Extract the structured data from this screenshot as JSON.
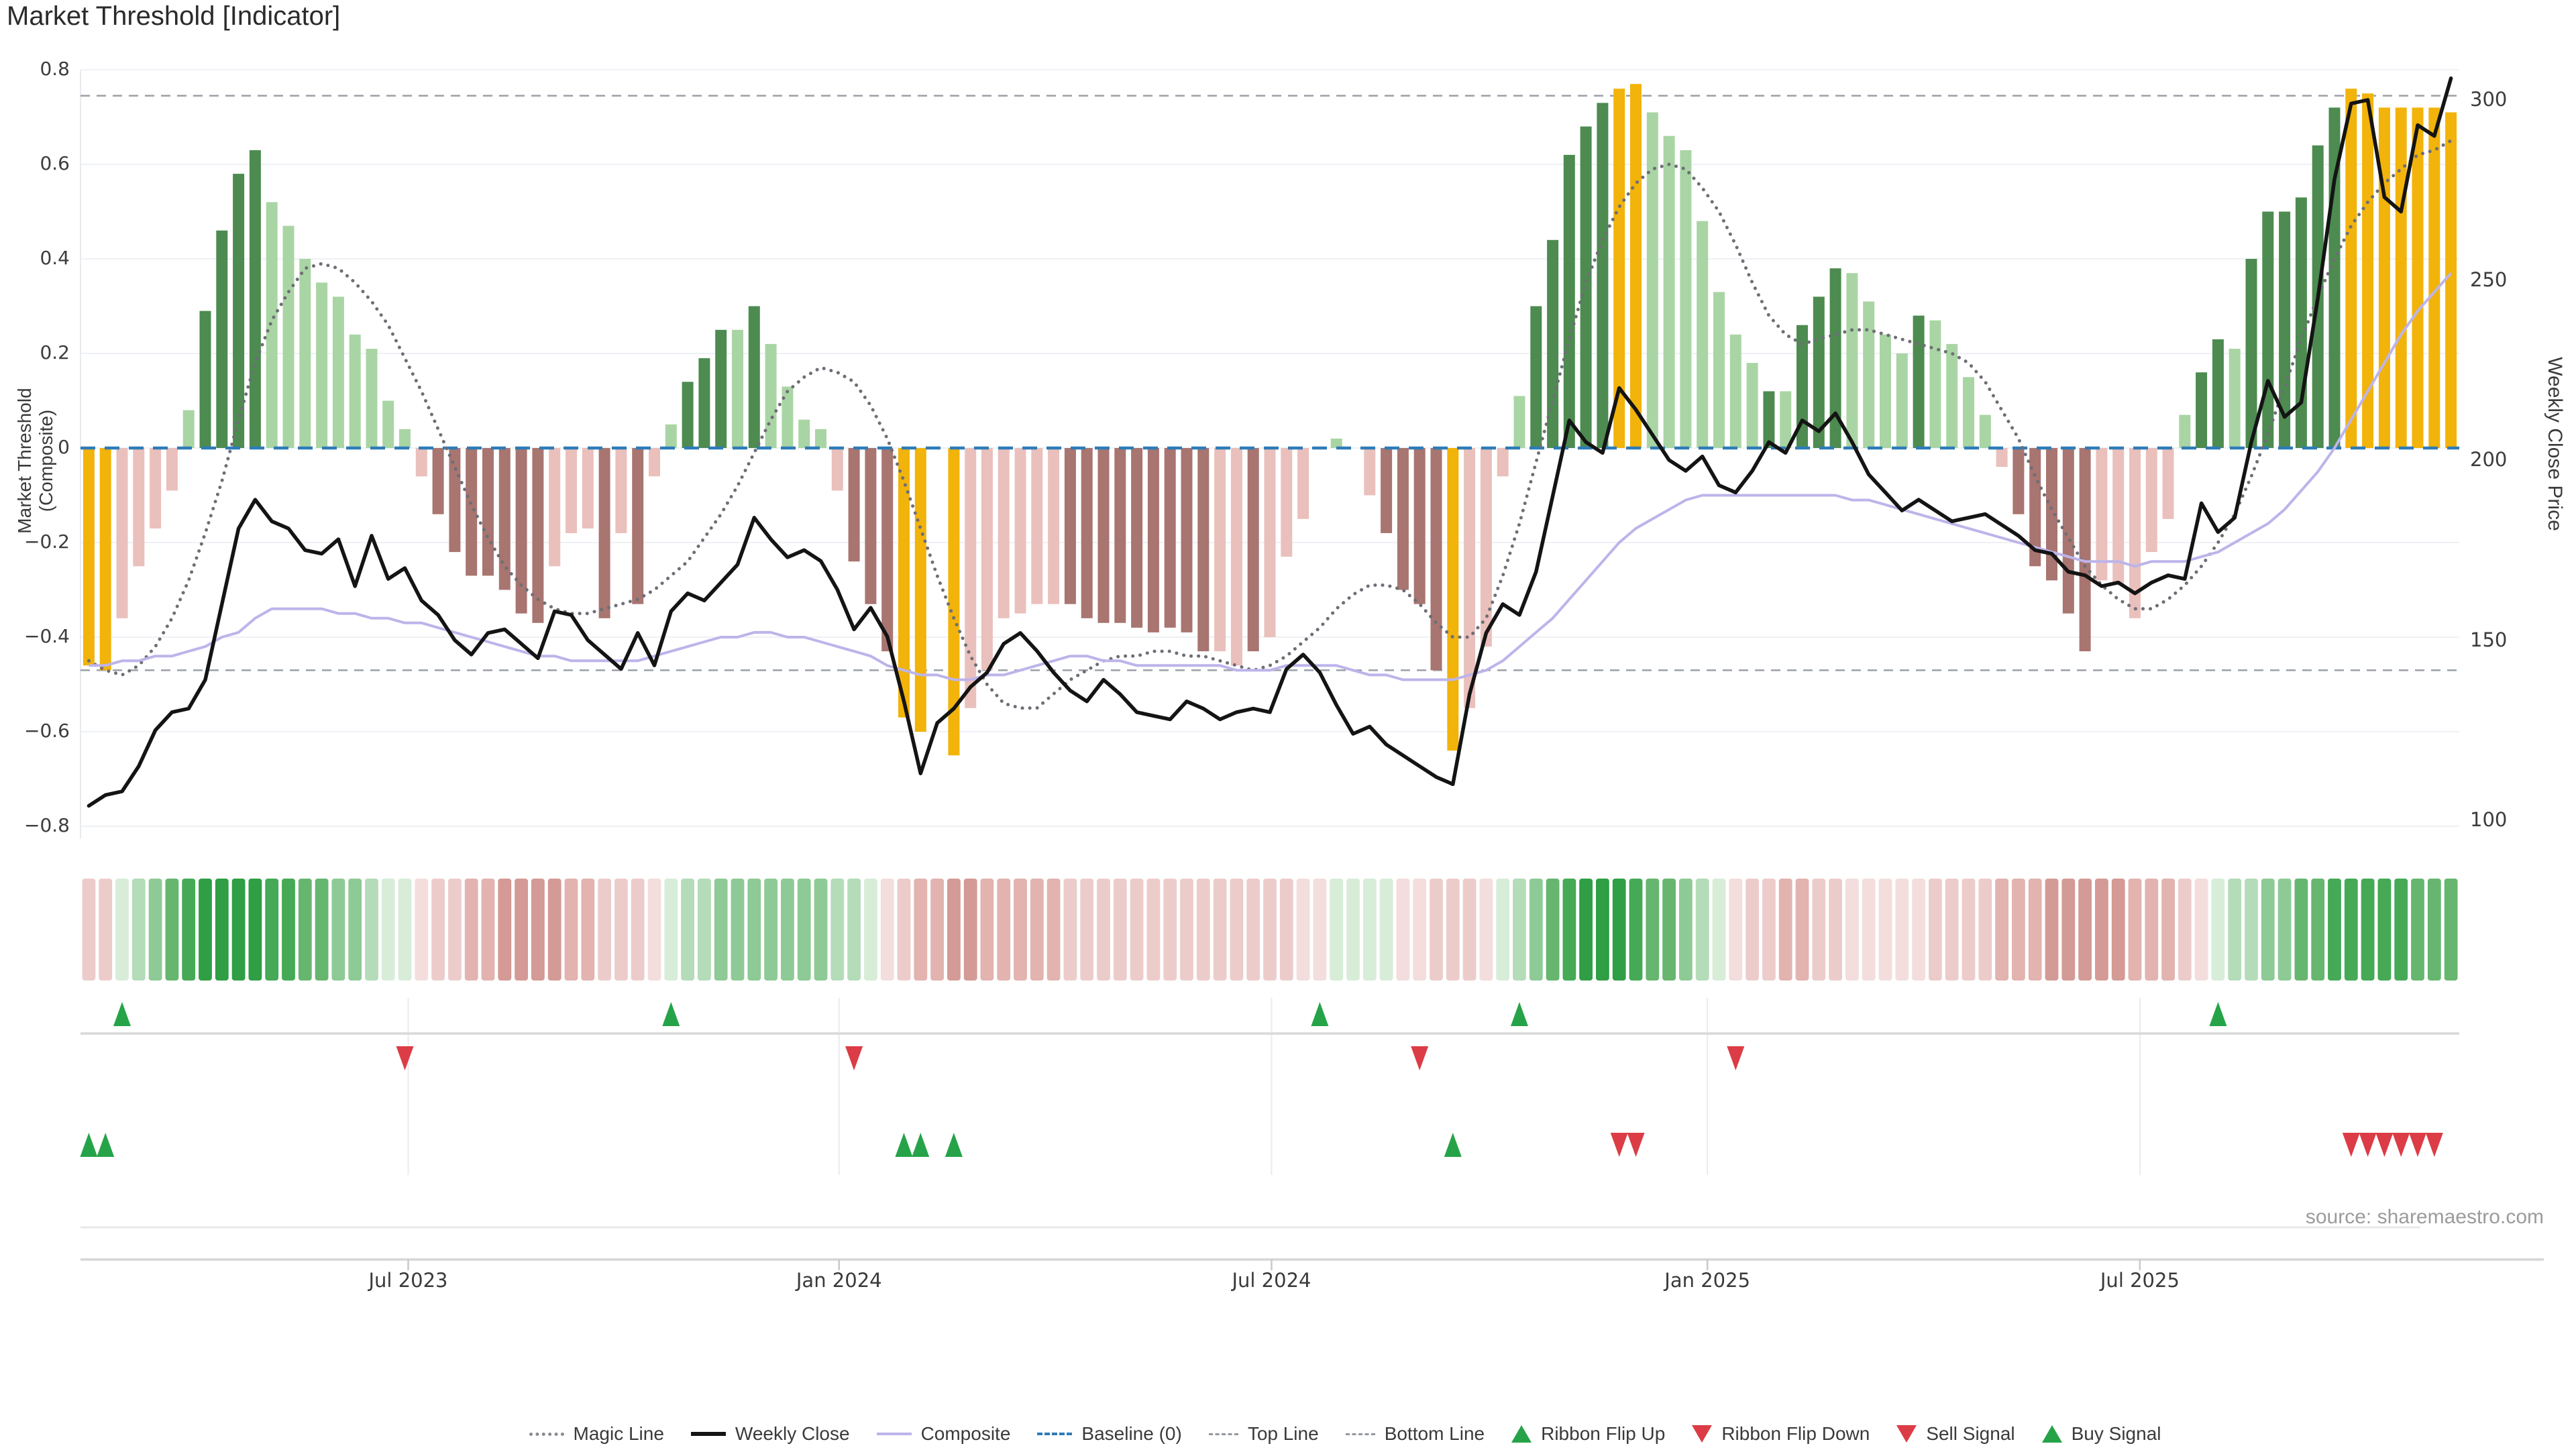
{
  "title": "Market Threshold [Indicator]",
  "source": "source: sharemaestro.com",
  "axes": {
    "left_label": "Market Threshold (Composite)",
    "right_label": "Weekly Close Price",
    "left_ticks": [
      0.8,
      0.6,
      0.4,
      0.2,
      0,
      -0.2,
      -0.4,
      -0.6,
      -0.8
    ],
    "left_tick_labels": [
      "0.8",
      "0.6",
      "0.4",
      "0.2",
      "0",
      "−0.2",
      "−0.4",
      "−0.6",
      "−0.8"
    ],
    "right_ticks": [
      300,
      250,
      200,
      150,
      100
    ],
    "x_ticks": [
      "Jul 2023",
      "Jan 2024",
      "Jul 2024",
      "Jan 2025",
      "Jul 2025"
    ],
    "x_tick_weeks": [
      19.7,
      45.6,
      71.6,
      97.8,
      123.8
    ]
  },
  "chart_data": {
    "type": "bar+line",
    "title": "Market Threshold [Indicator]",
    "ylabel_left": "Market Threshold (Composite)",
    "ylabel_right": "Weekly Close Price",
    "left_range": [
      -0.8,
      0.8
    ],
    "right_range": [
      100,
      300
    ],
    "baseline": 0,
    "top_line": 0.745,
    "bottom_line": -0.47,
    "grid": "horizontal",
    "n_weeks": 143,
    "threshold": [
      -0.46,
      -0.47,
      -0.36,
      -0.25,
      -0.17,
      -0.09,
      0.08,
      0.29,
      0.46,
      0.58,
      0.63,
      0.52,
      0.47,
      0.4,
      0.35,
      0.32,
      0.24,
      0.21,
      0.1,
      0.04,
      -0.06,
      -0.14,
      -0.22,
      -0.27,
      -0.27,
      -0.3,
      -0.35,
      -0.37,
      -0.25,
      -0.18,
      -0.17,
      -0.36,
      -0.18,
      -0.33,
      -0.06,
      0.05,
      0.14,
      0.19,
      0.25,
      0.25,
      0.3,
      0.22,
      0.13,
      0.06,
      0.04,
      -0.09,
      -0.24,
      -0.33,
      -0.43,
      -0.57,
      -0.6,
      0,
      -0.65,
      -0.55,
      -0.47,
      -0.36,
      -0.35,
      -0.33,
      -0.33,
      -0.33,
      -0.36,
      -0.37,
      -0.37,
      -0.38,
      -0.39,
      -0.38,
      -0.39,
      -0.43,
      -0.43,
      -0.46,
      -0.43,
      -0.4,
      -0.23,
      -0.15,
      0,
      0.02,
      0,
      -0.1,
      -0.18,
      -0.3,
      -0.33,
      -0.47,
      -0.64,
      -0.55,
      -0.42,
      -0.06,
      0.11,
      0.3,
      0.44,
      0.62,
      0.68,
      0.73,
      0.76,
      0.77,
      0.71,
      0.66,
      0.63,
      0.48,
      0.33,
      0.24,
      0.18,
      0.12,
      0.12,
      0.26,
      0.32,
      0.38,
      0.37,
      0.31,
      0.24,
      0.2,
      0.28,
      0.27,
      0.22,
      0.15,
      0.07,
      -0.04,
      -0.14,
      -0.25,
      -0.28,
      -0.35,
      -0.43,
      -0.28,
      -0.29,
      -0.36,
      -0.22,
      -0.15,
      0.07,
      0.16,
      0.23,
      0.21,
      0.4,
      0.5,
      0.5,
      0.53,
      0.64,
      0.72,
      0.76,
      0.75,
      0.72,
      0.72,
      0.72,
      0.72,
      0.71
    ],
    "bar_color_codes": [
      "au",
      "au",
      "p",
      "p",
      "p",
      "p",
      "lg",
      "g",
      "g",
      "g",
      "g",
      "lg",
      "lg",
      "lg",
      "lg",
      "lg",
      "lg",
      "lg",
      "lg",
      "lg",
      "p",
      "b",
      "b",
      "b",
      "b",
      "b",
      "b",
      "b",
      "p",
      "p",
      "p",
      "b",
      "p",
      "b",
      "p",
      "lg",
      "g",
      "g",
      "g",
      "lg",
      "g",
      "lg",
      "lg",
      "lg",
      "lg",
      "p",
      "b",
      "b",
      "b",
      "au",
      "au",
      "z",
      "au",
      "p",
      "p",
      "p",
      "p",
      "p",
      "p",
      "b",
      "b",
      "b",
      "b",
      "b",
      "b",
      "b",
      "b",
      "b",
      "p",
      "p",
      "b",
      "p",
      "p",
      "p",
      "z",
      "lg",
      "z",
      "p",
      "b",
      "b",
      "b",
      "b",
      "au",
      "p",
      "p",
      "p",
      "lg",
      "g",
      "g",
      "g",
      "g",
      "g",
      "au",
      "au",
      "lg",
      "lg",
      "lg",
      "lg",
      "lg",
      "lg",
      "lg",
      "g",
      "lg",
      "g",
      "g",
      "g",
      "lg",
      "lg",
      "lg",
      "lg",
      "g",
      "lg",
      "lg",
      "lg",
      "lg",
      "p",
      "b",
      "b",
      "b",
      "b",
      "b",
      "p",
      "p",
      "p",
      "p",
      "p",
      "lg",
      "g",
      "g",
      "lg",
      "g",
      "g",
      "g",
      "g",
      "g",
      "g",
      "au",
      "au",
      "au",
      "au",
      "au",
      "au",
      "au"
    ],
    "weekly_close": [
      104,
      107,
      108,
      115,
      125,
      130,
      131,
      139,
      160,
      181,
      189,
      183,
      181,
      175,
      174,
      178,
      165,
      179,
      167,
      170,
      161,
      157,
      150,
      146,
      152,
      153,
      149,
      145,
      158,
      157,
      150,
      146,
      142,
      152,
      143,
      158,
      163,
      161,
      166,
      171,
      184,
      178,
      173,
      175,
      172,
      164,
      153,
      159,
      151,
      133,
      113,
      127,
      131,
      137,
      141,
      149,
      152,
      147,
      141,
      136,
      133,
      139,
      135,
      130,
      129,
      128,
      133,
      131,
      128,
      130,
      131,
      130,
      142,
      146,
      141,
      132,
      124,
      126,
      121,
      118,
      115,
      112,
      110,
      135,
      152,
      160,
      157,
      169,
      190,
      211,
      205,
      202,
      220,
      214,
      207,
      200,
      197,
      201,
      193,
      191,
      197,
      205,
      202,
      211,
      208,
      213,
      205,
      196,
      191,
      186,
      189,
      186,
      183,
      184,
      185,
      182,
      179,
      175,
      174,
      169,
      168,
      165,
      166,
      163,
      166,
      168,
      167,
      188,
      180,
      184,
      205,
      222,
      212,
      216,
      245,
      278,
      299,
      300,
      273,
      269,
      293,
      290,
      306
    ],
    "composite": [
      -0.46,
      -0.46,
      -0.45,
      -0.45,
      -0.44,
      -0.44,
      -0.43,
      -0.42,
      -0.4,
      -0.39,
      -0.36,
      -0.34,
      -0.34,
      -0.34,
      -0.34,
      -0.35,
      -0.35,
      -0.36,
      -0.36,
      -0.37,
      -0.37,
      -0.38,
      -0.39,
      -0.4,
      -0.41,
      -0.42,
      -0.43,
      -0.44,
      -0.44,
      -0.45,
      -0.45,
      -0.45,
      -0.45,
      -0.45,
      -0.44,
      -0.43,
      -0.42,
      -0.41,
      -0.4,
      -0.4,
      -0.39,
      -0.39,
      -0.4,
      -0.4,
      -0.41,
      -0.42,
      -0.43,
      -0.44,
      -0.46,
      -0.47,
      -0.48,
      -0.48,
      -0.49,
      -0.49,
      -0.48,
      -0.48,
      -0.47,
      -0.46,
      -0.45,
      -0.44,
      -0.44,
      -0.45,
      -0.45,
      -0.46,
      -0.46,
      -0.46,
      -0.46,
      -0.46,
      -0.46,
      -0.47,
      -0.47,
      -0.47,
      -0.46,
      -0.46,
      -0.46,
      -0.46,
      -0.47,
      -0.48,
      -0.48,
      -0.49,
      -0.49,
      -0.49,
      -0.49,
      -0.48,
      -0.47,
      -0.45,
      -0.42,
      -0.39,
      -0.36,
      -0.32,
      -0.28,
      -0.24,
      -0.2,
      -0.17,
      -0.15,
      -0.13,
      -0.11,
      -0.1,
      -0.1,
      -0.1,
      -0.1,
      -0.1,
      -0.1,
      -0.1,
      -0.1,
      -0.1,
      -0.11,
      -0.11,
      -0.12,
      -0.13,
      -0.14,
      -0.15,
      -0.16,
      -0.17,
      -0.18,
      -0.19,
      -0.2,
      -0.21,
      -0.22,
      -0.23,
      -0.24,
      -0.24,
      -0.24,
      -0.25,
      -0.24,
      -0.24,
      -0.24,
      -0.23,
      -0.22,
      -0.2,
      -0.18,
      -0.16,
      -0.13,
      -0.09,
      -0.05,
      0,
      0.06,
      0.12,
      0.18,
      0.24,
      0.29,
      0.33,
      0.37
    ],
    "magic_line": [
      -0.45,
      -0.47,
      -0.48,
      -0.46,
      -0.42,
      -0.36,
      -0.28,
      -0.18,
      -0.07,
      0.06,
      0.18,
      0.27,
      0.33,
      0.38,
      0.39,
      0.38,
      0.35,
      0.31,
      0.26,
      0.19,
      0.12,
      0.04,
      -0.04,
      -0.12,
      -0.19,
      -0.25,
      -0.29,
      -0.32,
      -0.34,
      -0.35,
      -0.35,
      -0.34,
      -0.33,
      -0.32,
      -0.3,
      -0.27,
      -0.24,
      -0.19,
      -0.14,
      -0.08,
      -0.01,
      0.06,
      0.12,
      0.15,
      0.17,
      0.16,
      0.14,
      0.09,
      0.02,
      -0.07,
      -0.17,
      -0.27,
      -0.36,
      -0.44,
      -0.5,
      -0.54,
      -0.55,
      -0.55,
      -0.52,
      -0.49,
      -0.47,
      -0.45,
      -0.44,
      -0.44,
      -0.43,
      -0.43,
      -0.44,
      -0.44,
      -0.45,
      -0.46,
      -0.47,
      -0.46,
      -0.44,
      -0.41,
      -0.38,
      -0.34,
      -0.31,
      -0.29,
      -0.29,
      -0.3,
      -0.33,
      -0.37,
      -0.4,
      -0.4,
      -0.36,
      -0.27,
      -0.16,
      -0.03,
      0.1,
      0.23,
      0.35,
      0.44,
      0.51,
      0.56,
      0.59,
      0.6,
      0.59,
      0.55,
      0.5,
      0.43,
      0.35,
      0.28,
      0.24,
      0.22,
      0.23,
      0.24,
      0.25,
      0.25,
      0.24,
      0.23,
      0.22,
      0.21,
      0.2,
      0.18,
      0.14,
      0.08,
      0.02,
      -0.06,
      -0.13,
      -0.19,
      -0.25,
      -0.29,
      -0.32,
      -0.34,
      -0.34,
      -0.32,
      -0.29,
      -0.25,
      -0.2,
      -0.14,
      -0.06,
      0.03,
      0.13,
      0.23,
      0.32,
      0.4,
      0.47,
      0.52,
      0.56,
      0.59,
      0.62,
      0.63,
      0.65
    ],
    "ribbon": [
      -1,
      -1,
      0.5,
      1,
      1.5,
      2,
      2.5,
      3,
      3,
      3,
      3,
      2.5,
      2.5,
      2,
      2,
      1.5,
      1.5,
      1,
      0.5,
      0.5,
      -0.5,
      -1,
      -1,
      -1.5,
      -1.5,
      -2,
      -2,
      -2,
      -2,
      -1.5,
      -1.5,
      -1,
      -1,
      -1,
      -0.5,
      0.5,
      1,
      1,
      1.5,
      1.5,
      1.5,
      1.5,
      1.5,
      1.5,
      1.5,
      1,
      1,
      0.5,
      -0.5,
      -1,
      -1.5,
      -1.5,
      -2,
      -2,
      -1.5,
      -1.5,
      -1.5,
      -1.5,
      -1.5,
      -1,
      -1,
      -1,
      -1,
      -1,
      -1,
      -1,
      -1,
      -1,
      -1,
      -1,
      -1,
      -1,
      -1,
      -0.5,
      -0.5,
      0.5,
      0.5,
      0.5,
      0.5,
      -0.5,
      -0.5,
      -1,
      -1,
      -1,
      -0.5,
      0.5,
      1,
      1.5,
      2,
      2.5,
      3,
      3,
      3,
      2.5,
      2,
      2,
      1.5,
      1,
      0.5,
      -0.5,
      -1,
      -1,
      -1.5,
      -1.5,
      -1,
      -1,
      -0.5,
      -0.5,
      -0.5,
      -0.5,
      -0.5,
      -1,
      -1,
      -1,
      -1,
      -1.5,
      -1.5,
      -1.5,
      -2,
      -2,
      -2,
      -2,
      -2,
      -1.5,
      -1.5,
      -1.5,
      -1,
      -0.5,
      0.5,
      1,
      1,
      1.5,
      1.5,
      2,
      2,
      2.5,
      2.5,
      2.5,
      2.5,
      2.5,
      2,
      2,
      2
    ],
    "signals": {
      "ribbon_flip_up_weeks": [
        2,
        35,
        74,
        86,
        128
      ],
      "ribbon_flip_down_weeks": [
        19,
        46,
        80,
        99
      ],
      "buy_signal_weeks": [
        0,
        1,
        49,
        50,
        52,
        82
      ],
      "sell_signal_weeks": [
        92,
        93,
        136,
        137,
        138,
        139,
        140,
        141
      ]
    }
  },
  "colors": {
    "bar_palette": {
      "g": "#4d8b50",
      "lg": "#a9d5a4",
      "p": "#eac0bc",
      "b": "#a87570",
      "au": "#f2b30a",
      "z": "none"
    },
    "ribbon_palette": {
      "3": "#2f9e44",
      "2.5": "#45a956",
      "2": "#66b66f",
      "1.5": "#8eca95",
      "1": "#b4dcb9",
      "0.5": "#d7edd8",
      "-0.5": "#f3dedd",
      "-1": "#ecccca",
      "-1.5": "#e2b3af",
      "-2": "#d49a95",
      "-2.5": "#c8867f",
      "-3": "#bd736c"
    },
    "signal_green": "#26a348",
    "signal_red": "#dc3c45",
    "magic_line": "#6e6e76",
    "weekly_close": "#141414",
    "composite_line": "#bdb4ea",
    "baseline": "#2e7cb8",
    "band_lines": "#9aa0a6",
    "grid": "#eef1f5",
    "separator": "#d9d9d9"
  },
  "legend": {
    "items": [
      {
        "label": "Magic Line",
        "swatch": "dotted",
        "color": "#8a8a90",
        "thick": 5
      },
      {
        "label": "Weekly Close",
        "swatch": "solid",
        "color": "#141414",
        "thick": 6
      },
      {
        "label": "Composite",
        "swatch": "solid",
        "color": "#bdb4ea",
        "thick": 4
      },
      {
        "label": "Baseline (0)",
        "swatch": "dashed",
        "color": "#2e7cb8",
        "thick": 4
      },
      {
        "label": "Top Line",
        "swatch": "dashed-small",
        "color": "#94989e",
        "thick": 3
      },
      {
        "label": "Bottom Line",
        "swatch": "dashed-small",
        "color": "#94989e",
        "thick": 3
      },
      {
        "label": "Ribbon Flip Up",
        "swatch": "tri-up",
        "color": "#26a348"
      },
      {
        "label": "Ribbon Flip Down",
        "swatch": "tri-down",
        "color": "#dc3c45"
      },
      {
        "label": "Sell Signal",
        "swatch": "tri-down",
        "color": "#dc3c45"
      },
      {
        "label": "Buy Signal",
        "swatch": "tri-up",
        "color": "#26a348"
      }
    ]
  }
}
